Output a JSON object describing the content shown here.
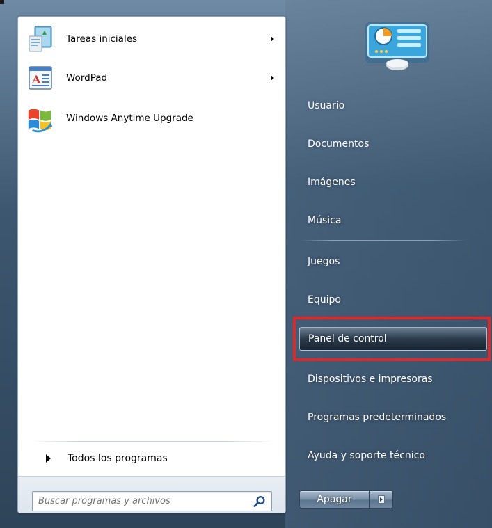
{
  "left_panel": {
    "programs": [
      {
        "label": "Tareas iniciales",
        "icon": "getting-started-icon",
        "has_submenu": true
      },
      {
        "label": "WordPad",
        "icon": "wordpad-icon",
        "has_submenu": true
      },
      {
        "label": "Windows Anytime Upgrade",
        "icon": "windows-flag-icon",
        "has_submenu": false
      }
    ],
    "all_programs_label": "Todos los programas",
    "search": {
      "placeholder": "Buscar programas y archivos",
      "icon": "search-icon"
    }
  },
  "right_panel": {
    "user_picture_icon": "control-panel-picture-icon",
    "links": [
      {
        "label": "Usuario"
      },
      {
        "label": "Documentos"
      },
      {
        "label": "Imágenes"
      },
      {
        "label": "Música"
      },
      {
        "label": "Juegos"
      },
      {
        "label": "Equipo"
      },
      {
        "label": "Panel de control",
        "selected": true
      },
      {
        "label": "Dispositivos e impresoras"
      },
      {
        "label": "Programas predeterminados"
      },
      {
        "label": "Ayuda y soporte técnico"
      }
    ],
    "shutdown_label": "Apagar",
    "highlight_color": "#e02828"
  }
}
